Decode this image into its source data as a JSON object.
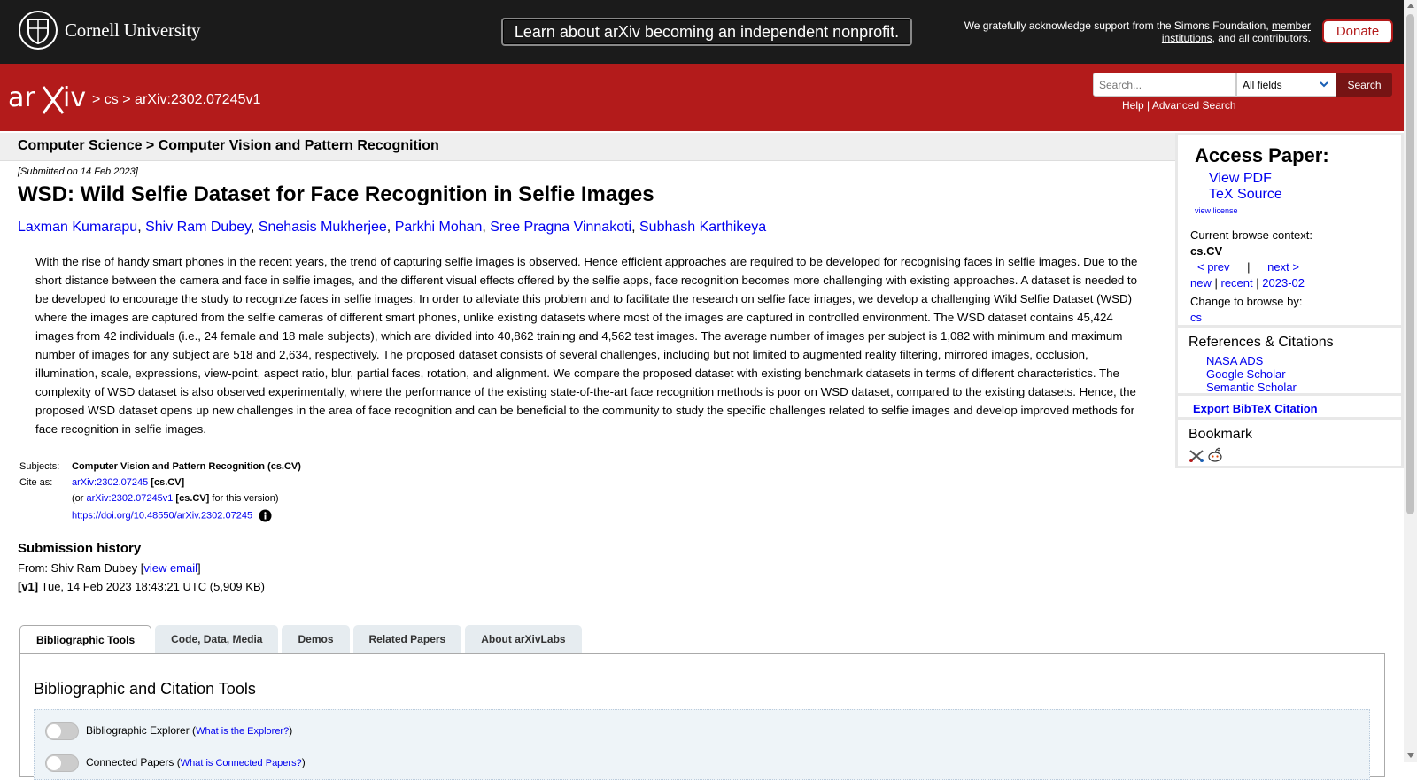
{
  "topbar": {
    "university": "Cornell University",
    "nonprofit_banner": "Learn about arXiv becoming an independent nonprofit.",
    "support_text_1": "We gratefully acknowledge support from the Simons Foundation, ",
    "support_link": "member institutions",
    "support_text_2": ", and all contributors.",
    "donate_label": "Donate"
  },
  "header": {
    "crumb_sep1": ">",
    "crumb_cs": "cs",
    "crumb_sep2": ">",
    "crumb_id": "arXiv:2302.07245v1",
    "search_placeholder": "Search...",
    "field_select": "All fields",
    "search_button": "Search",
    "help": "Help",
    "link_sep": "|",
    "advanced": "Advanced Search"
  },
  "paper": {
    "subject_bar": "Computer Science > Computer Vision and Pattern Recognition",
    "submitted": "[Submitted on 14 Feb 2023]",
    "title": "WSD: Wild Selfie Dataset for Face Recognition in Selfie Images",
    "authors": [
      "Laxman Kumarapu",
      "Shiv Ram Dubey",
      "Snehasis Mukherjee",
      "Parkhi Mohan",
      "Sree Pragna Vinnakoti",
      "Subhash Karthikeya"
    ],
    "author_sep": ", ",
    "abstract": "With the rise of handy smart phones in the recent years, the trend of capturing selfie images is observed. Hence efficient approaches are required to be developed for recognising faces in selfie images. Due to the short distance between the camera and face in selfie images, and the different visual effects offered by the selfie apps, face recognition becomes more challenging with existing approaches. A dataset is needed to be developed to encourage the study to recognize faces in selfie images. In order to alleviate this problem and to facilitate the research on selfie face images, we develop a challenging Wild Selfie Dataset (WSD) where the images are captured from the selfie cameras of different smart phones, unlike existing datasets where most of the images are captured in controlled environment. The WSD dataset contains 45,424 images from 42 individuals (i.e., 24 female and 18 male subjects), which are divided into 40,862 training and 4,562 test images. The average number of images per subject is 1,082 with minimum and maximum number of images for any subject are 518 and 2,634, respectively. The proposed dataset consists of several challenges, including but not limited to augmented reality filtering, mirrored images, occlusion, illumination, scale, expressions, view-point, aspect ratio, blur, partial faces, rotation, and alignment. We compare the proposed dataset with existing benchmark datasets in terms of different characteristics. The complexity of WSD dataset is also observed experimentally, where the performance of the existing state-of-the-art face recognition methods is poor on WSD dataset, compared to the existing datasets. Hence, the proposed WSD dataset opens up new challenges in the area of face recognition and can be beneficial to the community to study the specific challenges related to selfie images and develop improved methods for face recognition in selfie images.",
    "subjects_label": "Subjects:",
    "subjects_value": "Computer Vision and Pattern Recognition (cs.CV)",
    "cite_label": "Cite as:",
    "cite_link": "arXiv:2302.07245",
    "cite_cat": "[cs.CV]",
    "cite_or_open": "(or ",
    "cite_v1_link": "arXiv:2302.07245v1",
    "cite_v1_cat": "[cs.CV]",
    "cite_v1_tail": " for this version)",
    "doi": "https://doi.org/10.48550/arXiv.2302.07245"
  },
  "history": {
    "heading": "Submission history",
    "from_prefix": "From: Shiv Ram Dubey [",
    "view_email": "view email",
    "from_suffix": "]",
    "v1_label": "[v1]",
    "v1_text": " Tue, 14 Feb 2023 18:43:21 UTC (5,909 KB)"
  },
  "tabs": [
    "Bibliographic Tools",
    "Code, Data, Media",
    "Demos",
    "Related Papers",
    "About arXivLabs"
  ],
  "tools": {
    "heading": "Bibliographic and Citation Tools",
    "explorer_label": "Bibliographic Explorer (",
    "explorer_link": "What is the Explorer?",
    "explorer_close": ")",
    "connected_label": "Connected Papers (",
    "connected_link": "What is Connected Papers?",
    "connected_close": ")"
  },
  "sidebar": {
    "access_heading": "Access Paper:",
    "view_pdf": "View PDF",
    "tex_source": "TeX Source",
    "view_license": "view license",
    "browse_context_label": "Current browse context:",
    "browse_context": "cs.CV",
    "prev": "< prev",
    "nav_sep": "|",
    "next": "next >",
    "new": "new",
    "recent": "recent",
    "month": "2023-02",
    "change_label": "Change to browse by:",
    "change_cs": "cs",
    "refs_heading": "References & Citations",
    "nasa": "NASA ADS",
    "scholar": "Google Scholar",
    "semantic": "Semantic Scholar",
    "export_bibtex": "Export BibTeX Citation",
    "bookmark_heading": "Bookmark"
  },
  "colors": {
    "arxiv_red": "#b31b1b",
    "top_bar": "#1b1b1b",
    "link": "#0000ee"
  }
}
